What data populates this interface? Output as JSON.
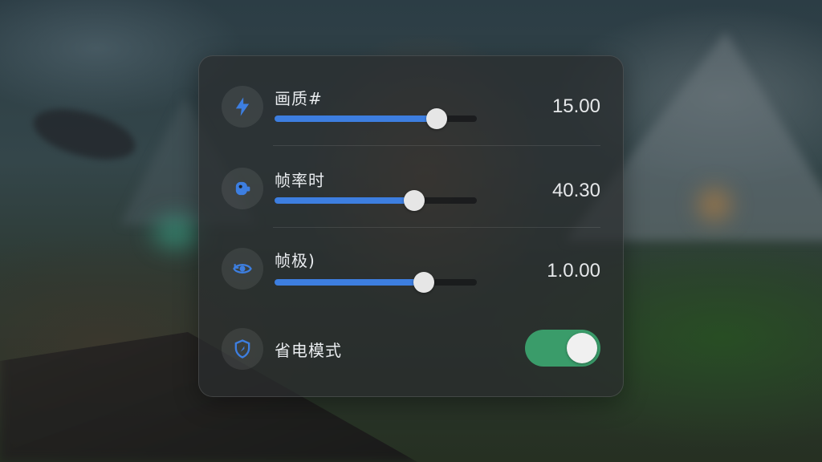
{
  "settings": {
    "rows": [
      {
        "label": "画质#",
        "value": "15.00",
        "slider_level": 0.8,
        "icon": "lightning-bolt-icon"
      },
      {
        "label": "帧率时",
        "value": "40.30",
        "slider_level": 0.69,
        "icon": "camera-icon"
      },
      {
        "label": "帧极)",
        "value": "1.0.00",
        "slider_level": 0.74,
        "icon": "eye-refresh-icon"
      }
    ],
    "power_saving": {
      "label": "省电模式",
      "enabled": true,
      "icon": "shield-icon"
    }
  },
  "colors": {
    "accent": "#3d7ee0",
    "toggle_on": "#3a9c6a",
    "panel_bg": "#2a2c2e"
  }
}
